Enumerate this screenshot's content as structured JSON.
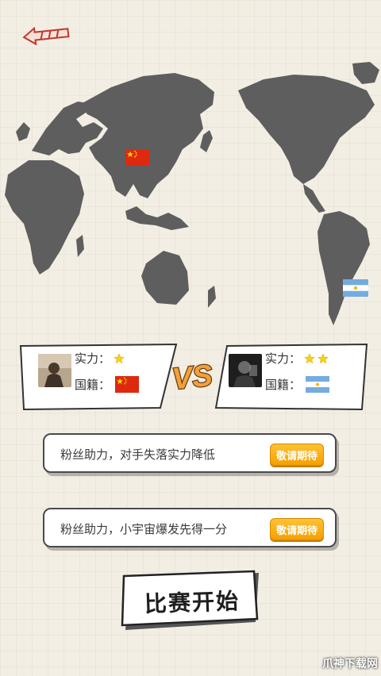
{
  "opponents": {
    "left": {
      "strength_label": "实力：",
      "strength_stars": 1,
      "nationality_label": "国籍：",
      "flag": "china-flag-icon"
    },
    "right": {
      "strength_label": "实力：",
      "strength_stars": 2,
      "nationality_label": "国籍：",
      "flag": "argentina-flag-icon"
    },
    "vs_label": "VS"
  },
  "boosts": [
    {
      "text": "粉丝助力，对手失落实力降低",
      "button": "敬请期待"
    },
    {
      "text": "粉丝助力，小宇宙爆发先得一分",
      "button": "敬请期待"
    }
  ],
  "start_button": "比赛开始",
  "watermark": "爪神下载网",
  "colors": {
    "background": "#f3eee4",
    "continents": "#5e5e5e",
    "accent_orange": "#f5a000",
    "star_yellow": "#f7d21c",
    "vs_orange": "#f0a23a"
  }
}
